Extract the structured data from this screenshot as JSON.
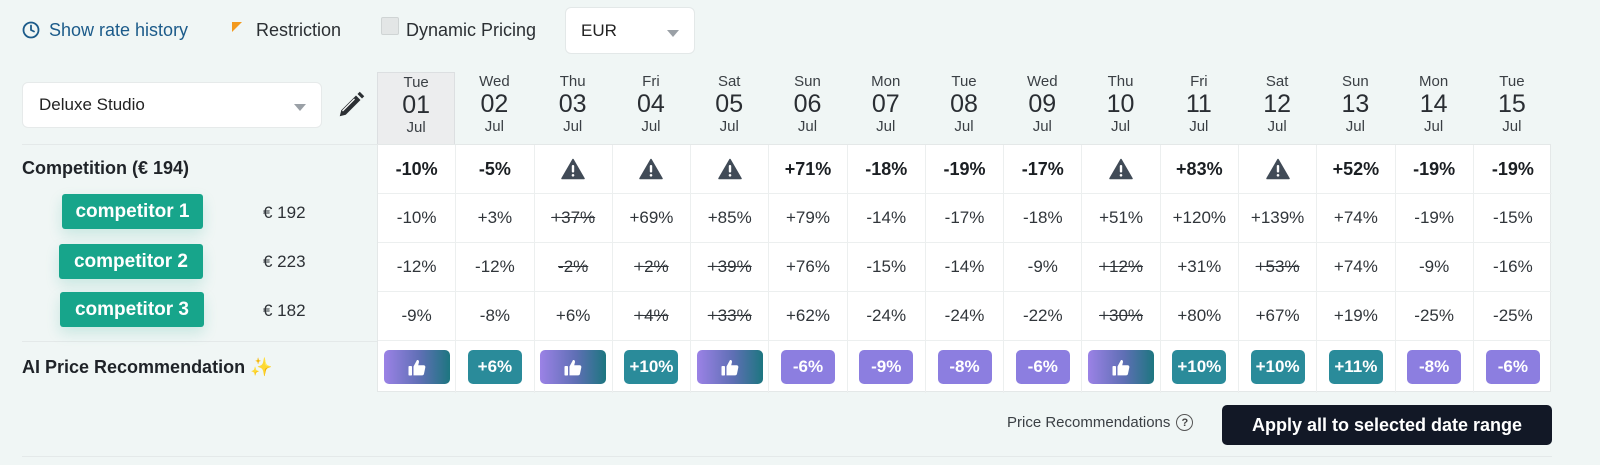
{
  "toolbar": {
    "history_label": "Show rate history",
    "restriction_label": "Restriction",
    "dynamic_label": "Dynamic Pricing",
    "currency": "EUR"
  },
  "room": {
    "selected": "Deluxe Studio"
  },
  "dates": [
    {
      "dow": "Tue",
      "day": "01",
      "mon": "Jul"
    },
    {
      "dow": "Wed",
      "day": "02",
      "mon": "Jul"
    },
    {
      "dow": "Thu",
      "day": "03",
      "mon": "Jul"
    },
    {
      "dow": "Fri",
      "day": "04",
      "mon": "Jul"
    },
    {
      "dow": "Sat",
      "day": "05",
      "mon": "Jul"
    },
    {
      "dow": "Sun",
      "day": "06",
      "mon": "Jul"
    },
    {
      "dow": "Mon",
      "day": "07",
      "mon": "Jul"
    },
    {
      "dow": "Tue",
      "day": "08",
      "mon": "Jul"
    },
    {
      "dow": "Wed",
      "day": "09",
      "mon": "Jul"
    },
    {
      "dow": "Thu",
      "day": "10",
      "mon": "Jul"
    },
    {
      "dow": "Fri",
      "day": "11",
      "mon": "Jul"
    },
    {
      "dow": "Sat",
      "day": "12",
      "mon": "Jul"
    },
    {
      "dow": "Sun",
      "day": "13",
      "mon": "Jul"
    },
    {
      "dow": "Mon",
      "day": "14",
      "mon": "Jul"
    },
    {
      "dow": "Tue",
      "day": "15",
      "mon": "Jul"
    }
  ],
  "competition": {
    "label": "Competition (€ 194)",
    "values": [
      "-10%",
      "-5%",
      "",
      "",
      "",
      "+71%",
      "-18%",
      "-19%",
      "-17%",
      "",
      "+83%",
      "",
      "+52%",
      "-19%",
      "-19%"
    ],
    "warnings": [
      false,
      false,
      true,
      true,
      true,
      false,
      false,
      false,
      false,
      true,
      false,
      true,
      false,
      false,
      false
    ]
  },
  "competitors": [
    {
      "name": "competitor 1",
      "price": "€ 192",
      "values": [
        "-10%",
        "+3%",
        "+37%",
        "+69%",
        "+85%",
        "+79%",
        "-14%",
        "-17%",
        "-18%",
        "+51%",
        "+120%",
        "+139%",
        "+74%",
        "-19%",
        "-15%"
      ],
      "strike": [
        false,
        false,
        true,
        false,
        false,
        false,
        false,
        false,
        false,
        false,
        false,
        false,
        false,
        false,
        false
      ]
    },
    {
      "name": "competitor 2",
      "price": "€ 223",
      "values": [
        "-12%",
        "-12%",
        "-2%",
        "+2%",
        "+39%",
        "+76%",
        "-15%",
        "-14%",
        "-9%",
        "+12%",
        "+31%",
        "+53%",
        "+74%",
        "-9%",
        "-16%"
      ],
      "strike": [
        false,
        false,
        true,
        true,
        true,
        false,
        false,
        false,
        false,
        true,
        false,
        true,
        false,
        false,
        false
      ]
    },
    {
      "name": "competitor 3",
      "price": "€ 182",
      "values": [
        "-9%",
        "-8%",
        "+6%",
        "+4%",
        "+33%",
        "+62%",
        "-24%",
        "-24%",
        "-22%",
        "+30%",
        "+80%",
        "+67%",
        "+19%",
        "-25%",
        "-25%"
      ],
      "strike": [
        false,
        false,
        false,
        true,
        true,
        false,
        false,
        false,
        false,
        true,
        false,
        false,
        false,
        false,
        false
      ]
    }
  ],
  "ai": {
    "label": "AI Price Recommendation ✨",
    "recs": [
      {
        "type": "thumb",
        "text": ""
      },
      {
        "type": "up",
        "text": "+6%"
      },
      {
        "type": "thumb",
        "text": ""
      },
      {
        "type": "up",
        "text": "+10%"
      },
      {
        "type": "thumb",
        "text": ""
      },
      {
        "type": "down",
        "text": "-6%"
      },
      {
        "type": "down",
        "text": "-9%"
      },
      {
        "type": "down",
        "text": "-8%"
      },
      {
        "type": "down",
        "text": "-6%"
      },
      {
        "type": "thumb",
        "text": ""
      },
      {
        "type": "up",
        "text": "+10%"
      },
      {
        "type": "up",
        "text": "+10%"
      },
      {
        "type": "up",
        "text": "+11%"
      },
      {
        "type": "down",
        "text": "-8%"
      },
      {
        "type": "down",
        "text": "-6%"
      }
    ]
  },
  "footer": {
    "price_rec_label": "Price Recommendations",
    "help_glyph": "?",
    "apply_label": "Apply all to selected date range"
  },
  "colors": {
    "accent_teal": "#17a58b",
    "rec_up": "#2a8b9a",
    "rec_down": "#8c7ee0",
    "history_link": "#1c5b8a",
    "restriction_marker": "#f39a1e",
    "apply_button": "#121826"
  },
  "icons": {
    "history": "clock-icon",
    "edit": "pencil-icon",
    "warning": "warning-icon",
    "thumb": "thumbs-up-icon",
    "help": "help-circle-icon"
  }
}
